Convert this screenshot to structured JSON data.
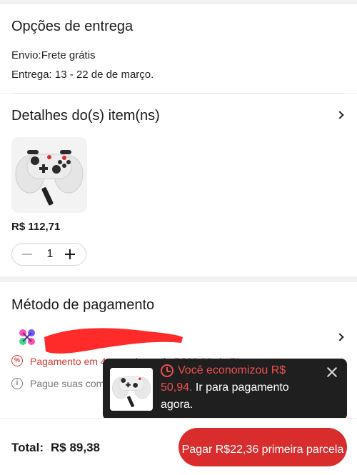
{
  "delivery": {
    "title": "Opções de entrega",
    "shipping": "Envio:Frete grátis",
    "eta": "Entrega: 13 - 22 de de março."
  },
  "items": {
    "title": "Detalhes do(s) item(ns)",
    "product": {
      "image_icon": "gamepad-controller-with-usb-receiver",
      "price": "R$ 112,71",
      "quantity": "1"
    }
  },
  "payment": {
    "title": "Método de pagamento",
    "method_icon": "pix-logo",
    "promo_icon": "percent-icon",
    "promo_text": "Pagamento em 4x sem juros de R$22,36 via Pi",
    "info_icon": "info-icon",
    "info_text": "Pague suas compras em 4x sem juros via Pix juros e sem cartão."
  },
  "tooltip": {
    "clock_icon": "clock-icon",
    "highlight": "Você economizou R$ 50,94.",
    "message": " Ir para pagamento agora.",
    "close_icon": "close-icon"
  },
  "footer": {
    "total_label": "Total:",
    "total_value": "R$ 89,38",
    "pay_button": "Pagar R$22,36 primeira parcela"
  },
  "colors": {
    "accent": "#d92d2d",
    "tooltip_bg": "#1f1f1f",
    "highlight_text": "#f05050"
  }
}
